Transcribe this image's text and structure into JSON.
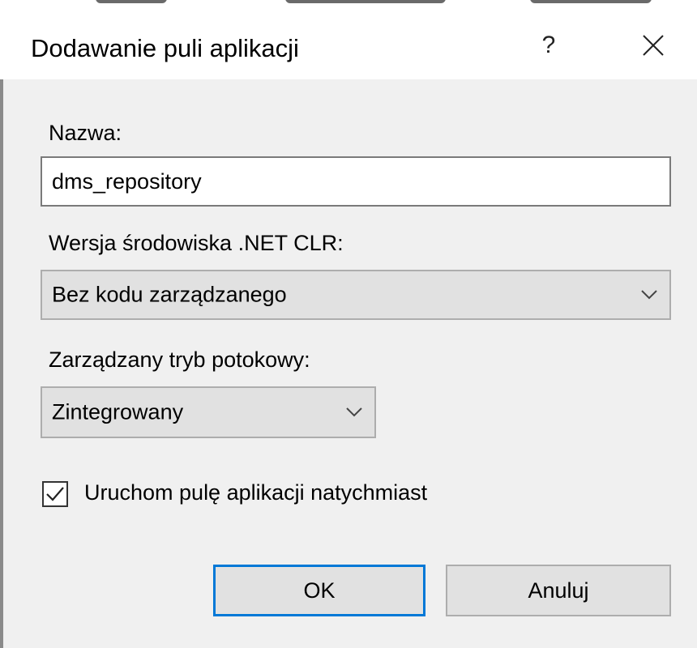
{
  "window": {
    "title": "Dodawanie puli aplikacji",
    "help_glyph": "?",
    "close_glyph": "✕"
  },
  "form": {
    "name_label": "Nazwa:",
    "name_value": "dms_repository",
    "clr_label": "Wersja środowiska .NET CLR:",
    "clr_value": "Bez kodu zarządzanego",
    "pipeline_label": "Zarządzany tryb potokowy:",
    "pipeline_value": "Zintegrowany",
    "start_checkbox_label": "Uruchom pulę aplikacji natychmiast",
    "start_checkbox_checked": true
  },
  "buttons": {
    "ok_label": "OK",
    "cancel_label": "Anuluj"
  },
  "colors": {
    "accent": "#0078d7",
    "dialog_bg": "#f0f0f0",
    "control_bg": "#e1e1e1"
  },
  "icons": {
    "close": "close-icon",
    "help": "help-icon",
    "dropdown": "chevron-down-icon",
    "check": "checkmark-icon"
  }
}
